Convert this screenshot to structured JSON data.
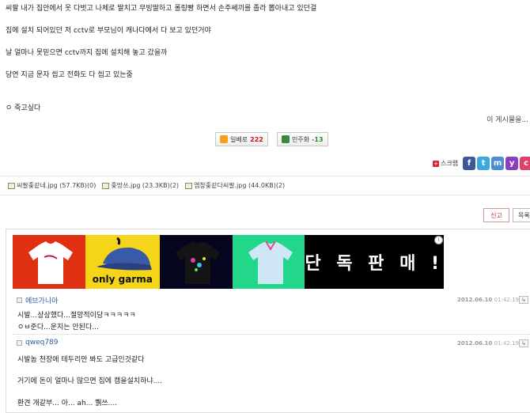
{
  "post": {
    "lines": [
      "씨팔 내가 집안에서 옷 다벗고 나체로 딸치고 무빙딸하고 롤링빵 하면서 손주쎄끼를 졸라 뽑아내고 있던걸",
      "집에 설치 되어있던 저 cctv로 부모님이 캐나다에서 다 보고 있던거야",
      "날 얼마나 못믿으면 cctv까지 집에 설치해 놓고 갔을까",
      "당연 지금 문자 씹고 전화도 다 씹고 있는중",
      "ㅇ 죽고싶다"
    ],
    "share_note": "이 게시물을..."
  },
  "votes": {
    "up_label": "일베로",
    "up_count": "222",
    "down_label": "민주화",
    "down_count": "-13"
  },
  "scrap": {
    "label": "스크랩",
    "sns_icons": [
      "facebook-icon",
      "twitter-icon",
      "me2day-icon",
      "yozm-icon",
      "cyworld-icon",
      "google-icon"
    ]
  },
  "attachments": [
    "씨팔좆같네.jpg (57.7KB)(0)",
    "좆망쓰.jpg (23.3KB)(2)",
    "엠창좆같다씨팔.jpg (44.0KB)(2)"
  ],
  "buttons": {
    "report": "신고",
    "list": "목록"
  },
  "ad": {
    "brand": "only garma",
    "headline": "단 독 판 매 !",
    "info": "i"
  },
  "comments": [
    {
      "author": "에브가니아",
      "date": "2012.06.10",
      "time": "01:42:19",
      "lines": [
        "시발...상상했다...절망적이당ㅋㅋㅋㅋㅋ",
        "ㅇㅂ준다...운지는 안된다..."
      ]
    },
    {
      "author": "qweq789",
      "date": "2012.06.10",
      "time": "01:42:19",
      "lines": [
        "시발놈 천장에 테두리만 봐도 고급인것같다",
        "거기에 돈이 얼마나 많으면 집에 캠을설치하냐....",
        "환견 개같부... 아... ah... 쀍쓰...."
      ]
    }
  ],
  "colors": {
    "up_count": "#d01010",
    "down_count": "#2a8a2a",
    "author": "#2a5aa0",
    "report_text": "#d02020"
  }
}
